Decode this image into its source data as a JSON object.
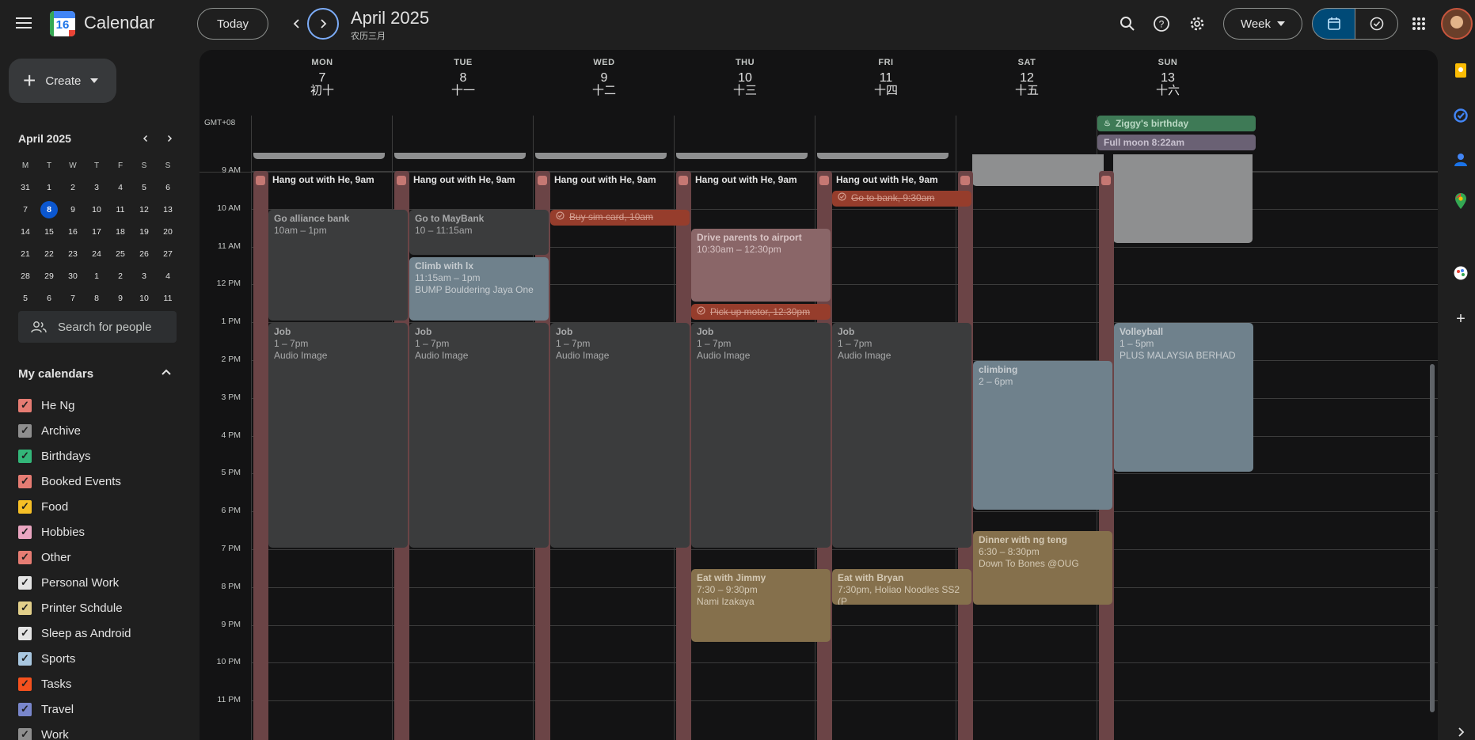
{
  "app": {
    "title": "Calendar",
    "logo_day": "16"
  },
  "header": {
    "today": "Today",
    "period": "April 2025",
    "period_sub": "农历三月",
    "view": "Week"
  },
  "sidebar": {
    "create": "Create",
    "mini": {
      "title": "April 2025",
      "dows": [
        "M",
        "T",
        "W",
        "T",
        "F",
        "S",
        "S"
      ],
      "weeks": [
        [
          "31",
          "1",
          "2",
          "3",
          "4",
          "5",
          "6"
        ],
        [
          "7",
          "8",
          "9",
          "10",
          "11",
          "12",
          "13"
        ],
        [
          "14",
          "15",
          "16",
          "17",
          "18",
          "19",
          "20"
        ],
        [
          "21",
          "22",
          "23",
          "24",
          "25",
          "26",
          "27"
        ],
        [
          "28",
          "29",
          "30",
          "1",
          "2",
          "3",
          "4"
        ],
        [
          "5",
          "6",
          "7",
          "8",
          "9",
          "10",
          "11"
        ]
      ],
      "today": "8"
    },
    "search_people": "Search for people",
    "my_calendars_title": "My calendars",
    "calendars": [
      {
        "name": "He Ng",
        "color": "#e67c73"
      },
      {
        "name": "Archive",
        "color": "#8e8e8e"
      },
      {
        "name": "Birthdays",
        "color": "#33b679"
      },
      {
        "name": "Booked Events",
        "color": "#e67c73"
      },
      {
        "name": "Food",
        "color": "#f6bf26"
      },
      {
        "name": "Hobbies",
        "color": "#e9a5c0"
      },
      {
        "name": "Other",
        "color": "#e67c73"
      },
      {
        "name": "Personal Work",
        "color": "#e3e3e3"
      },
      {
        "name": "Printer Schdule",
        "color": "#e2cf8a"
      },
      {
        "name": "Sleep as Android",
        "color": "#e3e3e3"
      },
      {
        "name": "Sports",
        "color": "#a8c7e0"
      },
      {
        "name": "Tasks",
        "color": "#f4511e"
      },
      {
        "name": "Travel",
        "color": "#7986cb"
      },
      {
        "name": "Work",
        "color": "#8e8e8e"
      }
    ]
  },
  "week": {
    "timezone": "GMT+08",
    "days": [
      {
        "dow": "MON",
        "num": "7",
        "lunar": "初十"
      },
      {
        "dow": "TUE",
        "num": "8",
        "lunar": "十一"
      },
      {
        "dow": "WED",
        "num": "9",
        "lunar": "十二"
      },
      {
        "dow": "THU",
        "num": "10",
        "lunar": "十三"
      },
      {
        "dow": "FRI",
        "num": "11",
        "lunar": "十四"
      },
      {
        "dow": "SAT",
        "num": "12",
        "lunar": "十五"
      },
      {
        "dow": "SUN",
        "num": "13",
        "lunar": "十六"
      }
    ],
    "hours": [
      "9 AM",
      "10 AM",
      "11 AM",
      "12 PM",
      "1 PM",
      "2 PM",
      "3 PM",
      "4 PM",
      "5 PM",
      "6 PM",
      "7 PM",
      "8 PM",
      "9 PM",
      "10 PM",
      "11 PM"
    ],
    "allday": [
      {
        "title": "Ziggy's birthday",
        "day": 6,
        "color": "#3e7a56"
      },
      {
        "title": "Full moon 8:22am",
        "day": 6,
        "color": "#6a6174"
      }
    ],
    "hang_out": "Hang out with He, 9am",
    "events": {
      "mon_bank": {
        "t": "Go alliance bank",
        "time": "10am – 1pm"
      },
      "tue_bank": {
        "t": "Go to MayBank",
        "time": "10 – 11:15am"
      },
      "tue_climb": {
        "t": "Climb with lx",
        "time": "11:15am – 1pm",
        "loc": "BUMP Bouldering Jaya One"
      },
      "wed_task": "Buy sim card, 10am",
      "thu_airport": {
        "t": "Drive parents to airport",
        "time": "10:30am – 12:30pm"
      },
      "thu_task": "Pick up motor, 12:30pm",
      "fri_task": "Go to bank, 9:30am",
      "job": {
        "t": "Job",
        "time": "1 – 7pm",
        "loc": "Audio Image"
      },
      "sat_climb": {
        "t": "climbing",
        "time": "2 – 6pm"
      },
      "sat_dinner": {
        "t": "Dinner with ng teng",
        "time": "6:30 – 8:30pm",
        "loc": "Down To Bones @OUG"
      },
      "sun_volley": {
        "t": "Volleyball",
        "time": "1 – 5pm",
        "loc": "PLUS MALAYSIA BERHAD"
      },
      "thu_eat": {
        "t": "Eat with Jimmy",
        "time": "7:30 – 9:30pm",
        "loc": "Nami Izakaya"
      },
      "fri_eat": {
        "t": "Eat with Bryan",
        "time": "7:30pm, Holiao Noodles SS2 (P"
      }
    }
  }
}
